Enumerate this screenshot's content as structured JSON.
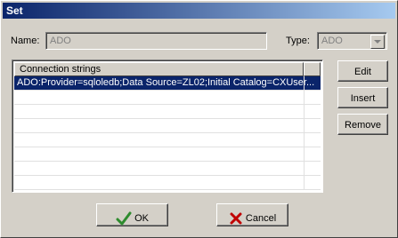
{
  "window": {
    "title": "Set"
  },
  "form": {
    "name_label": "Name:",
    "name_value": "ADO",
    "type_label": "Type:",
    "type_value": "ADO"
  },
  "connections": {
    "header": "Connection strings",
    "items": [
      "ADO:Provider=sqloledb;Data Source=ZL02;Initial Catalog=CXUser..."
    ]
  },
  "buttons": {
    "edit": "Edit",
    "insert": "Insert",
    "remove": "Remove",
    "ok": "OK",
    "cancel": "Cancel"
  },
  "colors": {
    "ok_check": "#2e8b2e",
    "cancel_x": "#c00000",
    "selection": "#0a246a"
  }
}
